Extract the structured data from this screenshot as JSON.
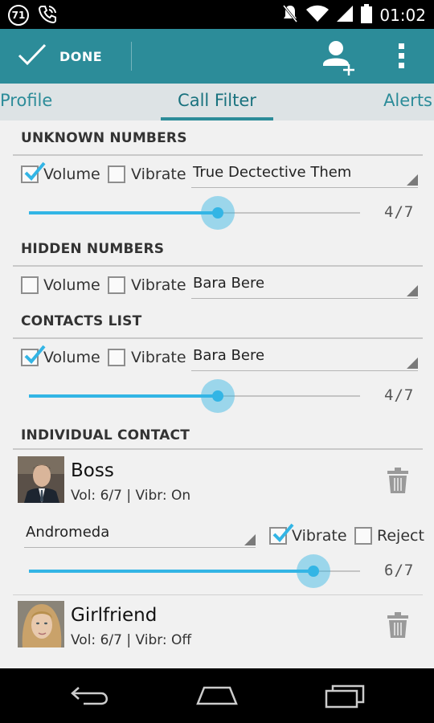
{
  "status_bar": {
    "badge": "71",
    "time": "01:02",
    "icons": [
      "phone-icon",
      "mute-icon",
      "wifi-icon",
      "signal-icon",
      "battery-icon"
    ]
  },
  "action_bar": {
    "done_label": "DONE",
    "icons": [
      "checkmark-icon",
      "add-contact-icon",
      "overflow-menu-icon"
    ],
    "color": "#2c8c99"
  },
  "tabs": [
    {
      "label": "Profile",
      "selected": false
    },
    {
      "label": "Call Filter",
      "selected": true
    },
    {
      "label": "Alerts",
      "selected": false
    }
  ],
  "sections": {
    "unknown": {
      "title": "UNKNOWN NUMBERS",
      "volume_label": "Volume",
      "volume_checked": true,
      "vibrate_label": "Vibrate",
      "vibrate_checked": false,
      "ringtone": "True Dectective Them",
      "slider_value": "4/7",
      "slider_level": 4,
      "slider_max": 7
    },
    "hidden": {
      "title": "HIDDEN NUMBERS",
      "volume_label": "Volume",
      "volume_checked": false,
      "vibrate_label": "Vibrate",
      "vibrate_checked": false,
      "ringtone": "Bara Bere"
    },
    "contacts": {
      "title": "CONTACTS LIST",
      "volume_label": "Volume",
      "volume_checked": true,
      "vibrate_label": "Vibrate",
      "vibrate_checked": false,
      "ringtone": "Bara Bere",
      "slider_value": "4/7",
      "slider_level": 4,
      "slider_max": 7
    },
    "individual": {
      "title": "INDIVIDUAL CONTACT",
      "contacts": [
        {
          "name": "Boss",
          "summary": "Vol: 6/7 | Vibr: On",
          "ringtone": "Andromeda",
          "vibrate_label": "Vibrate",
          "vibrate_checked": true,
          "reject_label": "Reject",
          "reject_checked": false,
          "slider_value": "6/7",
          "slider_level": 6,
          "slider_max": 7,
          "expanded": true
        },
        {
          "name": "Girlfriend",
          "summary": "Vol: 6/7 | Vibr: Off",
          "expanded": false
        }
      ]
    }
  },
  "colors": {
    "accent": "#33b5e5",
    "primary": "#2c8c99"
  }
}
